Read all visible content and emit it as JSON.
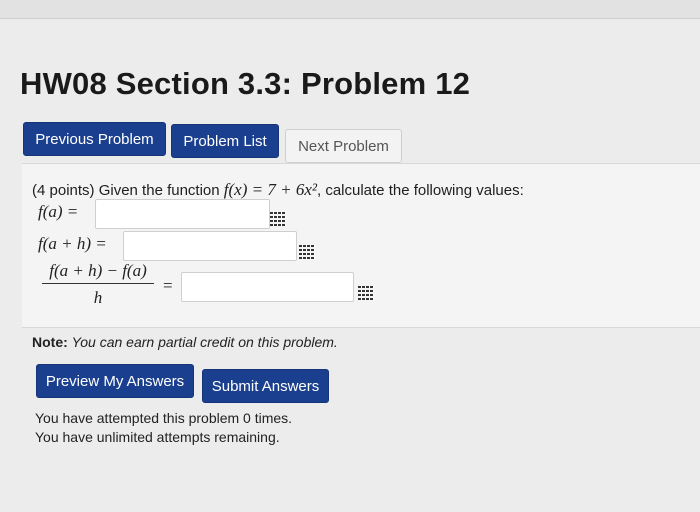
{
  "title": "HW08 Section 3.3: Problem 12",
  "nav": {
    "previous": "Previous Problem",
    "list": "Problem List",
    "next": "Next Problem"
  },
  "problem": {
    "points": "(4 points)",
    "intro": "Given the function",
    "function": "f(x) = 7 + 6x²",
    "task": ", calculate the following values:",
    "labels": {
      "fa": "f(a) =",
      "fah": "f(a + h) =",
      "numerator": "f(a + h) − f(a)",
      "denominator": "h",
      "eq": "="
    },
    "answers": [
      "",
      "",
      ""
    ]
  },
  "note": {
    "label": "Note:",
    "text": "You can earn partial credit on this problem."
  },
  "actions": {
    "preview": "Preview My Answers",
    "submit": "Submit Answers"
  },
  "status": {
    "attempted": "You have attempted this problem 0 times.",
    "remaining": "You have unlimited attempts remaining."
  },
  "colors": {
    "primary_button": "#1b3f8f",
    "disabled_button": "#f3f3f3",
    "panel": "#f4f4f4"
  }
}
